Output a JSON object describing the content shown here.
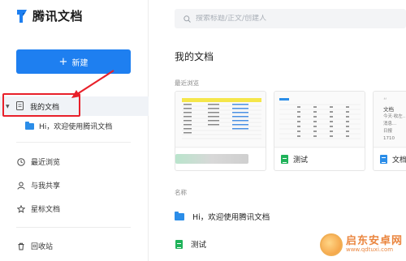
{
  "app": {
    "title": "腾讯文档"
  },
  "sidebar": {
    "new_button": "新建",
    "my_docs": "我的文档",
    "sub_items": [
      {
        "label": "Hi，欢迎使用腾讯文档"
      }
    ],
    "items": [
      {
        "label": "最近浏览",
        "icon": "clock-icon"
      },
      {
        "label": "与我共享",
        "icon": "person-icon"
      },
      {
        "label": "星标文档",
        "icon": "star-icon"
      },
      {
        "label": "回收站",
        "icon": "trash-icon"
      }
    ]
  },
  "search": {
    "placeholder": "搜索标题/正文/创建人"
  },
  "main": {
    "title": "我的文档",
    "recent_label": "最近浏览",
    "recent_cards": [
      {
        "name": "",
        "icon": "spreadsheet-icon"
      },
      {
        "name": "测试",
        "icon": "spreadsheet-icon"
      },
      {
        "name": "文档",
        "icon": "document-icon",
        "preview_lines": [
          "文档",
          "今天·收左…",
          "消息…",
          "日报",
          "1710"
        ]
      }
    ],
    "list_header": "名称",
    "list_items": [
      {
        "name": "Hi，欢迎使用腾讯文档",
        "icon": "folder-icon"
      },
      {
        "name": "测试",
        "icon": "spreadsheet-icon"
      }
    ]
  },
  "watermark": {
    "brand": "启东安卓网",
    "url": "www.qdtuxi.com"
  },
  "colors": {
    "accent": "#1e7ff0",
    "highlight": "#e8202a",
    "sheet": "#1fb35a",
    "folder": "#2b8de8"
  }
}
